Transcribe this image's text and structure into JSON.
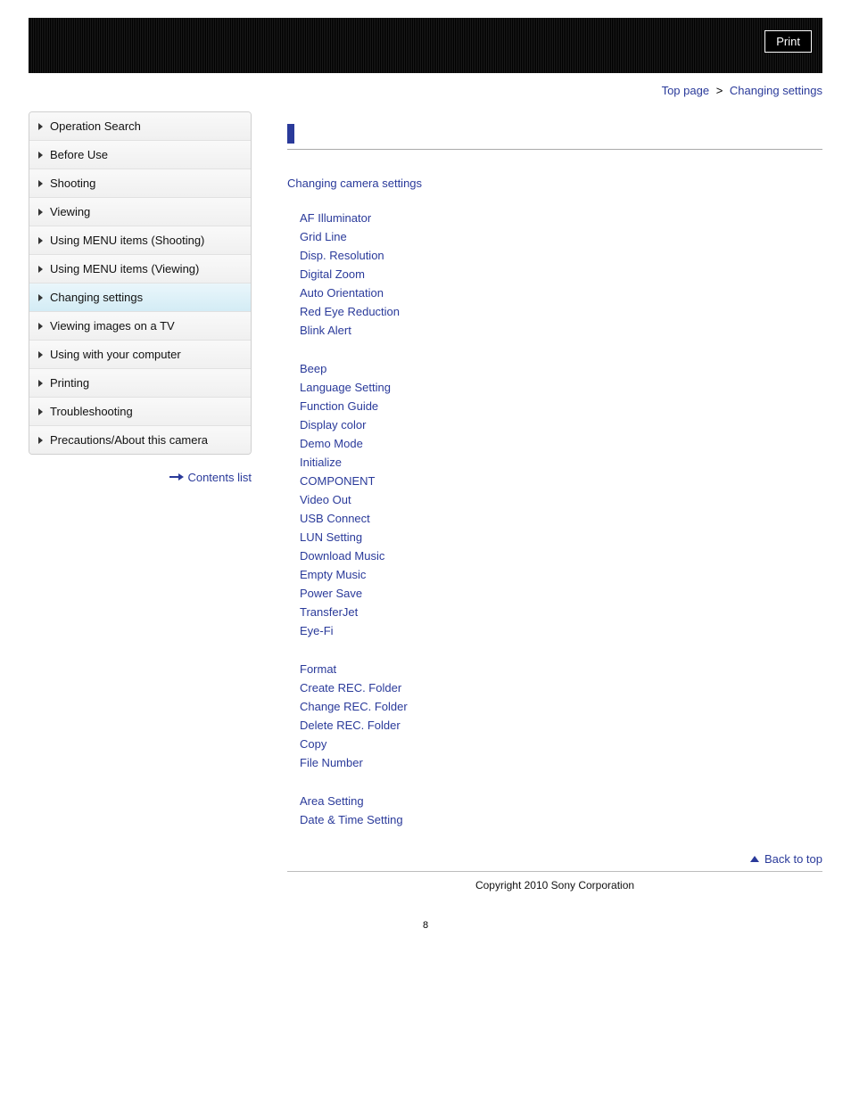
{
  "header": {
    "print_label": "Print"
  },
  "breadcrumb": {
    "top_label": "Top page",
    "sep": ">",
    "current": "Changing settings"
  },
  "sidebar": {
    "items": [
      {
        "label": "Operation Search"
      },
      {
        "label": "Before Use"
      },
      {
        "label": "Shooting"
      },
      {
        "label": "Viewing"
      },
      {
        "label": "Using MENU items (Shooting)"
      },
      {
        "label": "Using MENU items (Viewing)"
      },
      {
        "label": "Changing settings",
        "active": true
      },
      {
        "label": "Viewing images on a TV"
      },
      {
        "label": "Using with your computer"
      },
      {
        "label": "Printing"
      },
      {
        "label": "Troubleshooting"
      },
      {
        "label": "Precautions/About this camera"
      }
    ],
    "contents_list": "Contents list"
  },
  "main": {
    "section_title": "Changing camera settings",
    "groups": [
      {
        "name": "shooting-settings",
        "links": [
          "AF Illuminator",
          "Grid Line",
          "Disp. Resolution",
          "Digital Zoom",
          "Auto Orientation",
          "Red Eye Reduction",
          "Blink Alert"
        ]
      },
      {
        "name": "main-settings",
        "links": [
          "Beep",
          "Language Setting",
          "Function Guide",
          "Display color",
          "Demo Mode",
          "Initialize",
          "COMPONENT",
          "Video Out",
          "USB Connect",
          "LUN Setting",
          "Download Music",
          "Empty Music",
          "Power Save",
          "TransferJet",
          "Eye-Fi"
        ]
      },
      {
        "name": "memory-card-tool",
        "links": [
          "Format",
          "Create REC. Folder",
          "Change REC. Folder",
          "Delete REC. Folder",
          "Copy",
          "File Number"
        ]
      },
      {
        "name": "clock-settings",
        "links": [
          "Area Setting",
          "Date & Time Setting"
        ]
      }
    ],
    "back_to_top": "Back to top"
  },
  "footer": {
    "copyright": "Copyright 2010 Sony Corporation",
    "page_number": "8"
  }
}
